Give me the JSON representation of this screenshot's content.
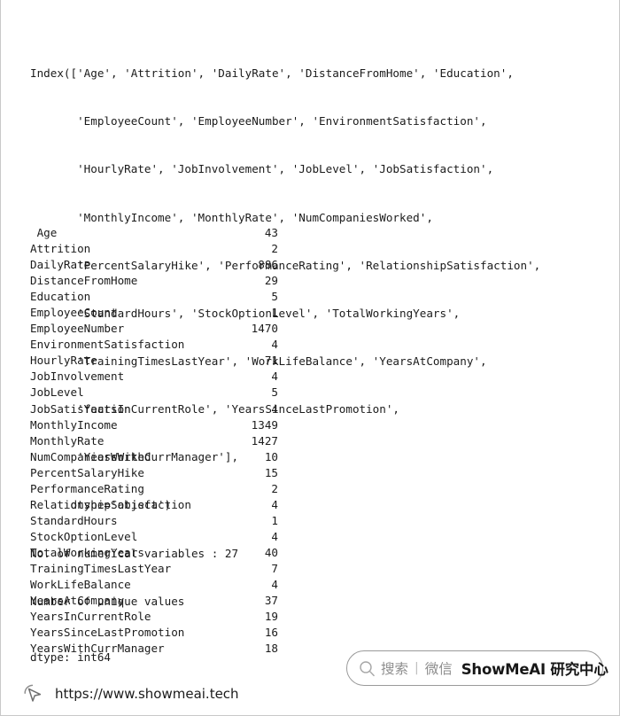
{
  "console": {
    "index_repr_lines": [
      "Index(['Age', 'Attrition', 'DailyRate', 'DistanceFromHome', 'Education',",
      "       'EmployeeCount', 'EmployeeNumber', 'EnvironmentSatisfaction',",
      "       'HourlyRate', 'JobInvolvement', 'JobLevel', 'JobSatisfaction',",
      "       'MonthlyIncome', 'MonthlyRate', 'NumCompaniesWorked',",
      "       'PercentSalaryHike', 'PerformanceRating', 'RelationshipSatisfaction',",
      "       'StandardHours', 'StockOptionLevel', 'TotalWorkingYears',",
      "       'TrainingTimesLastYear', 'WorkLifeBalance', 'YearsAtCompany',",
      "       'YearsInCurrentRole', 'YearsSinceLastPromotion',",
      "       'YearsWithCurrManager'],",
      "      dtype='object')",
      "No. of numerical variables : 27",
      "Number of unique values"
    ],
    "numerical_variable_count": "27",
    "unique_values_header": "Number of unique values",
    "dtype_line": "dtype: int64"
  },
  "unique_values": [
    {
      "name": " Age",
      "value": "43"
    },
    {
      "name": "Attrition",
      "value": "2"
    },
    {
      "name": "DailyRate",
      "value": "886"
    },
    {
      "name": "DistanceFromHome",
      "value": "29"
    },
    {
      "name": "Education",
      "value": "5"
    },
    {
      "name": "EmployeeCount",
      "value": "1"
    },
    {
      "name": "EmployeeNumber",
      "value": "1470"
    },
    {
      "name": "EnvironmentSatisfaction",
      "value": "4"
    },
    {
      "name": "HourlyRate",
      "value": "71"
    },
    {
      "name": "JobInvolvement",
      "value": "4"
    },
    {
      "name": "JobLevel",
      "value": "5"
    },
    {
      "name": "JobSatisfaction",
      "value": "4"
    },
    {
      "name": "MonthlyIncome",
      "value": "1349"
    },
    {
      "name": "MonthlyRate",
      "value": "1427"
    },
    {
      "name": "NumCompaniesWorked",
      "value": "10"
    },
    {
      "name": "PercentSalaryHike",
      "value": "15"
    },
    {
      "name": "PerformanceRating",
      "value": "2"
    },
    {
      "name": "RelationshipSatisfaction",
      "value": "4"
    },
    {
      "name": "StandardHours",
      "value": "1"
    },
    {
      "name": "StockOptionLevel",
      "value": "4"
    },
    {
      "name": "TotalWorkingYears",
      "value": "40"
    },
    {
      "name": "TrainingTimesLastYear",
      "value": "7"
    },
    {
      "name": "WorkLifeBalance",
      "value": "4"
    },
    {
      "name": "YearsAtCompany",
      "value": "37"
    },
    {
      "name": "YearsInCurrentRole",
      "value": "19"
    },
    {
      "name": "YearsSinceLastPromotion",
      "value": "16"
    },
    {
      "name": "YearsWithCurrManager",
      "value": "18"
    }
  ],
  "badge": {
    "search_label": "搜索",
    "separator": "|",
    "channel_label": "微信",
    "brand": "ShowMeAI 研究中心"
  },
  "footer": {
    "url": "https://www.showmeai.tech"
  },
  "colors": {
    "text": "#1b1b1b",
    "muted": "#8e8e8e",
    "border": "#c9c9c9",
    "badge_border": "#9a9a9a"
  }
}
